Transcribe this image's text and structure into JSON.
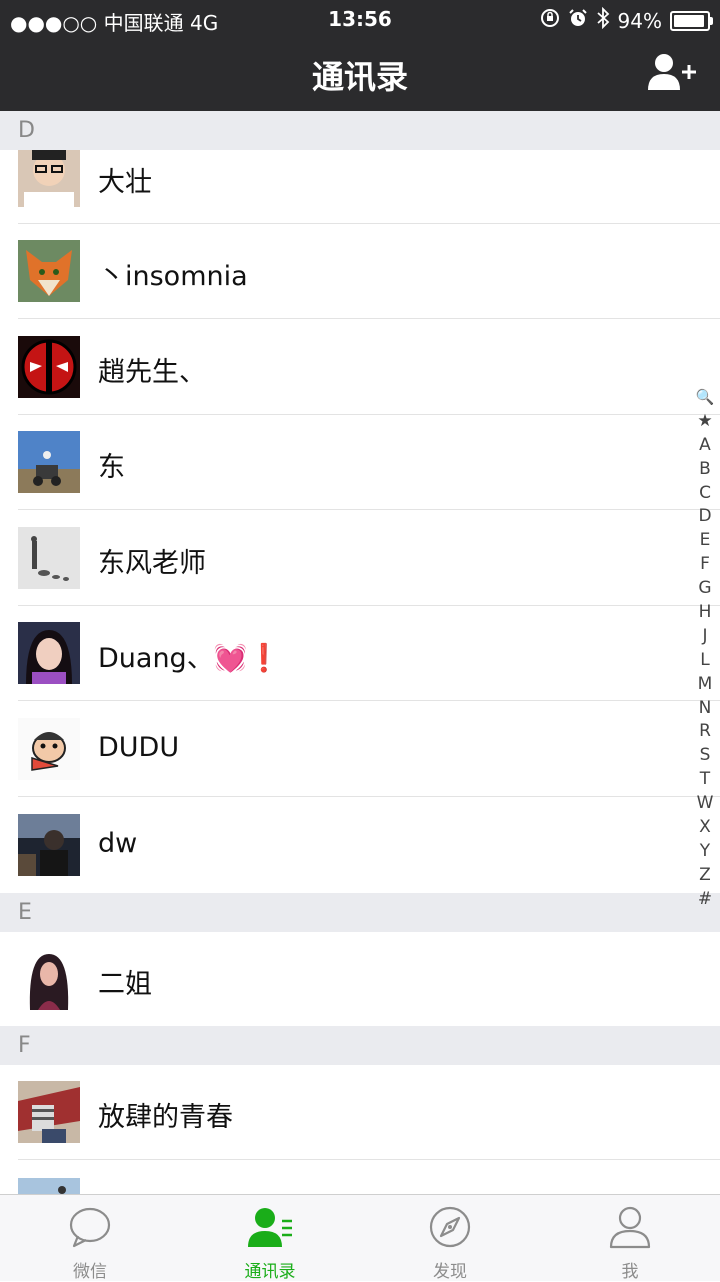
{
  "status_bar": {
    "carrier": "●●●○○ 中国联通  4G",
    "time": "13:56",
    "battery_text": "94%",
    "battery_level": 0.94
  },
  "nav": {
    "title": "通讯录"
  },
  "sections": [
    {
      "letter": "D"
    },
    {
      "letter": "E"
    },
    {
      "letter": "F"
    }
  ],
  "contacts": [
    {
      "name": "大壮",
      "section": "D"
    },
    {
      "name": "丶insomnia",
      "section": "D"
    },
    {
      "name": "趙先生、",
      "section": "D"
    },
    {
      "name": "东",
      "section": "D"
    },
    {
      "name": "东风老师",
      "section": "D"
    },
    {
      "name": "Duang、💓❗",
      "section": "D"
    },
    {
      "name": "DUDU",
      "section": "D"
    },
    {
      "name": "dw",
      "section": "D"
    },
    {
      "name": "二姐",
      "section": "E"
    },
    {
      "name": "放肆的青春",
      "section": "F"
    }
  ],
  "index_letters": [
    "🔍",
    "★",
    "A",
    "B",
    "C",
    "D",
    "E",
    "F",
    "G",
    "H",
    "J",
    "L",
    "M",
    "N",
    "R",
    "S",
    "T",
    "W",
    "X",
    "Y",
    "Z",
    "#"
  ],
  "tabs": [
    {
      "label": "微信",
      "icon": "chat-bubble-icon"
    },
    {
      "label": "通讯录",
      "icon": "contacts-icon",
      "active": true
    },
    {
      "label": "发现",
      "icon": "compass-icon"
    },
    {
      "label": "我",
      "icon": "person-icon"
    }
  ],
  "colors": {
    "accent": "#1aad19",
    "navbar": "#2b2b2d",
    "section_bg": "#eaebef"
  }
}
